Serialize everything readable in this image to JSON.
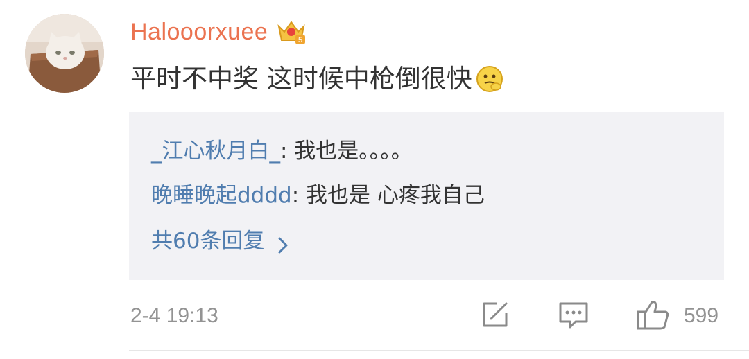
{
  "comment": {
    "username": "Halooorxuee",
    "badge_icon": "vip-crown-icon",
    "text": "平时不中奖 这时候中枪倒很快",
    "emoji_icon": "thinking-emoji-icon"
  },
  "replies": [
    {
      "author": "_江心秋月白_",
      "colon": ":",
      "text": " 我也是。。。。"
    },
    {
      "author": "晚睡晚起dddd",
      "colon": ":",
      "text": " 我也是 心疼我自己"
    }
  ],
  "more_replies": "共60条回复",
  "footer": {
    "timestamp": "2-4 19:13",
    "like_count": "599"
  },
  "colors": {
    "username": "#eb7350",
    "link_blue": "#507daf",
    "reply_bg": "#f2f2f5",
    "meta_gray": "#939393"
  }
}
